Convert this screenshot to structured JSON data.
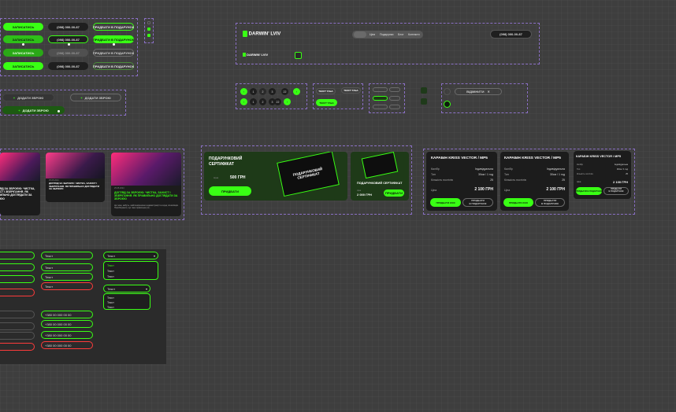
{
  "colors": {
    "accent": "#39ff14",
    "dark": "#1c1c1c",
    "bg": "#3e3e3e"
  },
  "buttons": {
    "enroll": "ЗАПИСАТИСЬ",
    "phone": "(098) 000-00-87",
    "sell_gift": "ПРИДБАТИ В ПОДАРУНОК",
    "add_weapon": "ДОДАТИ ЗБРОЮ",
    "buy": "ПРИДБАТИ",
    "buy_gift_two": "ПРИДБАТИ\nВ ПОДАРУНОК",
    "buy_2100": "ПРИДБАТИ 2100",
    "cancel": "ВІДМІНИТИ"
  },
  "header": {
    "logo": "DARWIN' LVIV",
    "nav": [
      "Ціни",
      "Подарунки",
      "Блог",
      "Контакти"
    ],
    "nav_active": "",
    "phone": "(098) 000-00-87"
  },
  "paging": {
    "top": [
      "1",
      "2",
      "3",
      "...",
      "22"
    ],
    "bottom": [
      "1",
      "2",
      "3",
      "...",
      "22"
    ]
  },
  "tags": {
    "a": "ТЕКСТ ТАБА",
    "b": "ТЕКСТ ТАБА",
    "c": "ТЕКСТ ТАБА"
  },
  "blog": {
    "card1_title": "ДОГЛЯД ЗА ЗБРОЄЮ: ЧИСТКА, ЗАХИСТ І ЗБЕРІГАННЯ. ЯК ПРАВИЛЬНО ДОГЛЯДАТИ ЗА ЗБРОЄЮ",
    "card2_title": "ДОГЛЯД ЗА ЗБРОЄЮ: ЧИСТКА, ЗАХИСТ І ЗБЕРІГАННЯ. ЯК ПРАВИЛЬНО ДОГЛЯДАТИ ЗА ЗБРОЄЮ",
    "card3_title": "ДОГЛЯД ЗА ЗБРОЄЮ: ЧИСТКА, ЗАХИСТ І ЗБЕРІГАННЯ. ЯК ПРАВИЛЬНО ДОГЛЯДАТИ ЗА ЗБРОЄЮ",
    "date": "25.05.2024",
    "excerpt": "Ця тема, мабуть, найпоширеніша в адміністрації та серед початківців. Порізбираюся, що таке правильна гра..."
  },
  "gift": {
    "title": "ПОДАРУНКОВИЙ СЕРТИФІКАТ",
    "price_label": "Ціна",
    "price": "500 ГРН",
    "small_title": "ПОДАРУНКОВИЙ СЕРТИФІКАТ",
    "small_price": "2 000 ГРН",
    "card_text": "ПОДАРУНКОВИЙ СЕРТИФІКАТ"
  },
  "weapon": {
    "title": "КАРАБІН KRISS VECTOR / MP5",
    "rows": [
      [
        "Калібр",
        "Індивідуальна"
      ],
      [
        "Тип",
        "30см / 1 год"
      ],
      [
        "Кількість постілів",
        "25"
      ]
    ],
    "price_label": "Ціна",
    "price": "2 100 ГРН"
  },
  "forms": {
    "text": "Текст",
    "phone_placeholder": "+380 00 000 00 00",
    "select_value": "Текст",
    "options": [
      "Текст",
      "Текст",
      "Текст"
    ]
  }
}
